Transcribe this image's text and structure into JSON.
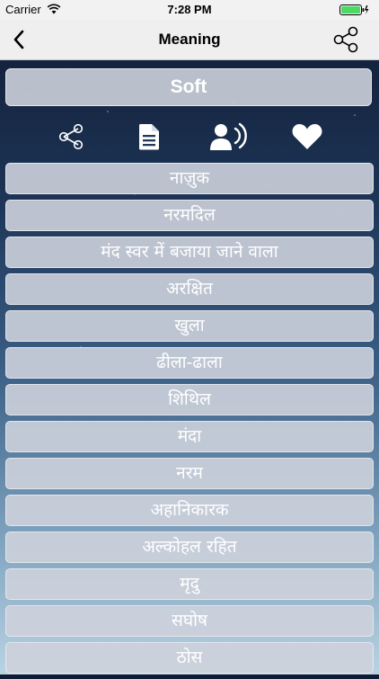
{
  "status_bar": {
    "carrier": "Carrier",
    "time": "7:28 PM"
  },
  "nav": {
    "title": "Meaning",
    "back_icon": "chevron-left-icon",
    "share_icon": "share-icon"
  },
  "word": "Soft",
  "actions": [
    {
      "name": "share-meaning-button",
      "icon": "share-icon"
    },
    {
      "name": "copy-document-button",
      "icon": "document-icon"
    },
    {
      "name": "speak-button",
      "icon": "speaker-voice-icon"
    },
    {
      "name": "favorite-button",
      "icon": "heart-icon"
    }
  ],
  "meanings": [
    "नाज़ुक",
    "नरमदिल",
    "मंद स्वर में बजाया जाने वाला",
    "अरक्षित",
    "खुला",
    "ढीला-ढाला",
    "शिथिल",
    "मंदा",
    "नरम",
    "अहानिकारक",
    "अल्कोहल रहित",
    "मृदु",
    "सघोष",
    "ठोस"
  ],
  "colors": {
    "background_top": "#101b33",
    "background_bottom": "#b9d3e2",
    "row_fill": "#cdd2dc",
    "text": "#ffffff"
  }
}
